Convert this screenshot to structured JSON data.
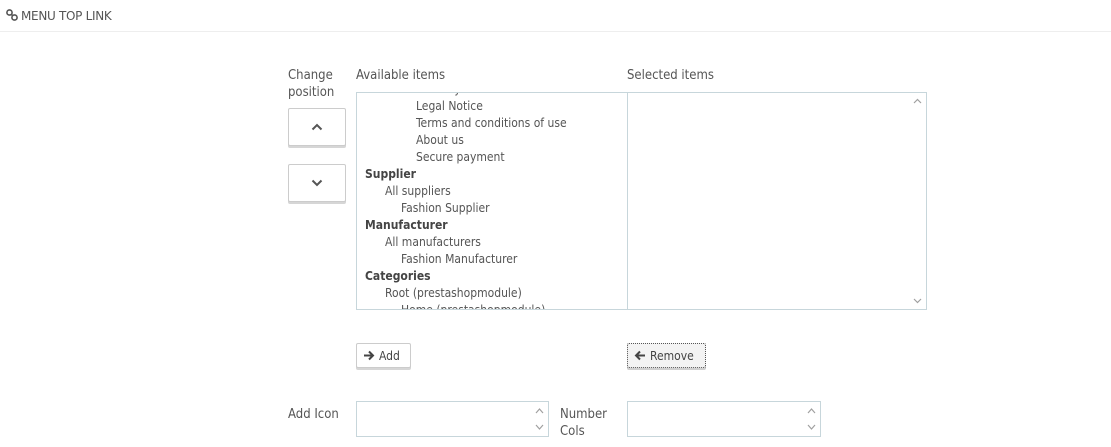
{
  "panel": {
    "title": "MENU TOP LINK",
    "icon": "link-icon"
  },
  "labels": {
    "change_position": "Change position",
    "available_items": "Available items",
    "selected_items": "Selected items",
    "add_icon": "Add Icon",
    "number_cols": "Number Cols"
  },
  "position_buttons": {
    "up_icon": "chevron-up-icon",
    "down_icon": "chevron-down-icon"
  },
  "available_items": [
    {
      "label": "Delivery",
      "level": "l3"
    },
    {
      "label": "Legal Notice",
      "level": "l3"
    },
    {
      "label": "Terms and conditions of use",
      "level": "l3"
    },
    {
      "label": "About us",
      "level": "l3"
    },
    {
      "label": "Secure payment",
      "level": "l3"
    },
    {
      "label": "Supplier",
      "level": "group"
    },
    {
      "label": "All suppliers",
      "level": "l1"
    },
    {
      "label": "Fashion Supplier",
      "level": "l2"
    },
    {
      "label": "Manufacturer",
      "level": "group"
    },
    {
      "label": "All manufacturers",
      "level": "l1"
    },
    {
      "label": "Fashion Manufacturer",
      "level": "l2"
    },
    {
      "label": "Categories",
      "level": "group"
    },
    {
      "label": "Root (prestashopmodule)",
      "level": "l1"
    },
    {
      "label": "Home (prestashopmodule)",
      "level": "l2"
    }
  ],
  "selected_items": [],
  "buttons": {
    "add": "Add",
    "remove": "Remove"
  },
  "inputs": {
    "add_icon_value": "",
    "number_cols_value": ""
  },
  "colors": {
    "text": "#555555",
    "border": "#c7d6db"
  }
}
